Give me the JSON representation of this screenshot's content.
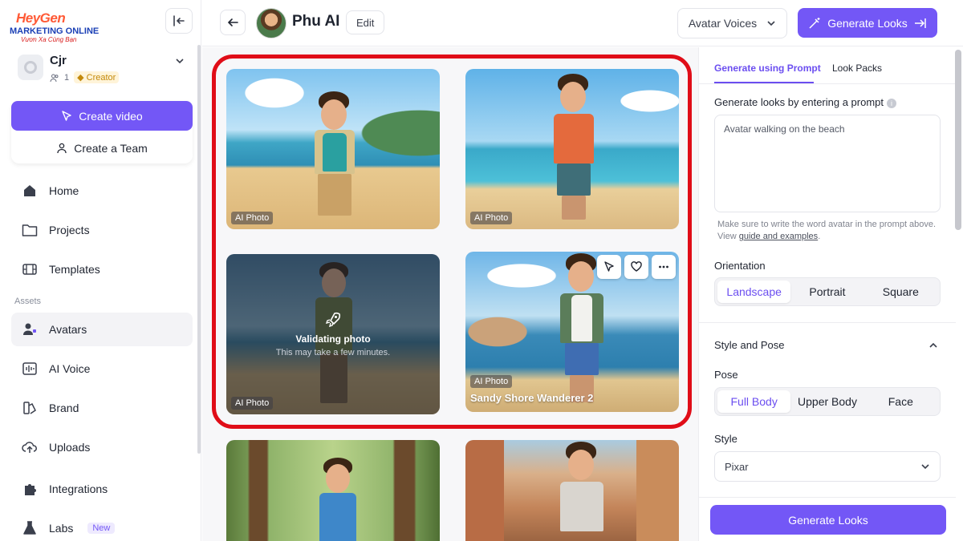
{
  "logo": {
    "line1": "HeyGen",
    "line2": "MARKETING ONLINE",
    "line3": "Vươn Xa Cùng Bạn"
  },
  "account": {
    "name": "Cjr",
    "members": "1",
    "plan": "Creator"
  },
  "sidebar": {
    "create_video": "Create video",
    "create_team": "Create a Team",
    "items": [
      {
        "label": "Home"
      },
      {
        "label": "Projects"
      },
      {
        "label": "Templates"
      },
      {
        "label": "Avatars"
      },
      {
        "label": "AI Voice"
      },
      {
        "label": "Brand"
      },
      {
        "label": "Uploads"
      },
      {
        "label": "Integrations"
      },
      {
        "label": "Labs",
        "badge": "New"
      }
    ],
    "section_assets": "Assets"
  },
  "header": {
    "title": "Phu AI",
    "edit": "Edit",
    "voices": "Avatar Voices",
    "generate": "Generate Looks"
  },
  "grid": {
    "cards": [
      {
        "label": "AI Photo"
      },
      {
        "label": "AI Photo"
      },
      {
        "label": "AI Photo",
        "status_title": "Validating photo",
        "status_sub": "This may take a few minutes."
      },
      {
        "label": "AI Photo",
        "title": "Sandy Shore Wanderer 2"
      }
    ]
  },
  "panel": {
    "tabs": [
      "Generate using Prompt",
      "Look Packs"
    ],
    "prompt_label": "Generate looks by entering a prompt",
    "prompt_value": "Avatar walking on the beach",
    "hint_text": "Make sure to write the word avatar in the prompt above. View",
    "hint_link": "guide and examples",
    "orientation_label": "Orientation",
    "orientation_options": [
      "Landscape",
      "Portrait",
      "Square"
    ],
    "style_pose_label": "Style and Pose",
    "pose_label": "Pose",
    "pose_options": [
      "Full Body",
      "Upper Body",
      "Face"
    ],
    "style_label": "Style",
    "style_value": "Pixar",
    "generate_button": "Generate Looks"
  },
  "colors": {
    "accent": "#7357f6",
    "highlight": "#e00d18"
  }
}
